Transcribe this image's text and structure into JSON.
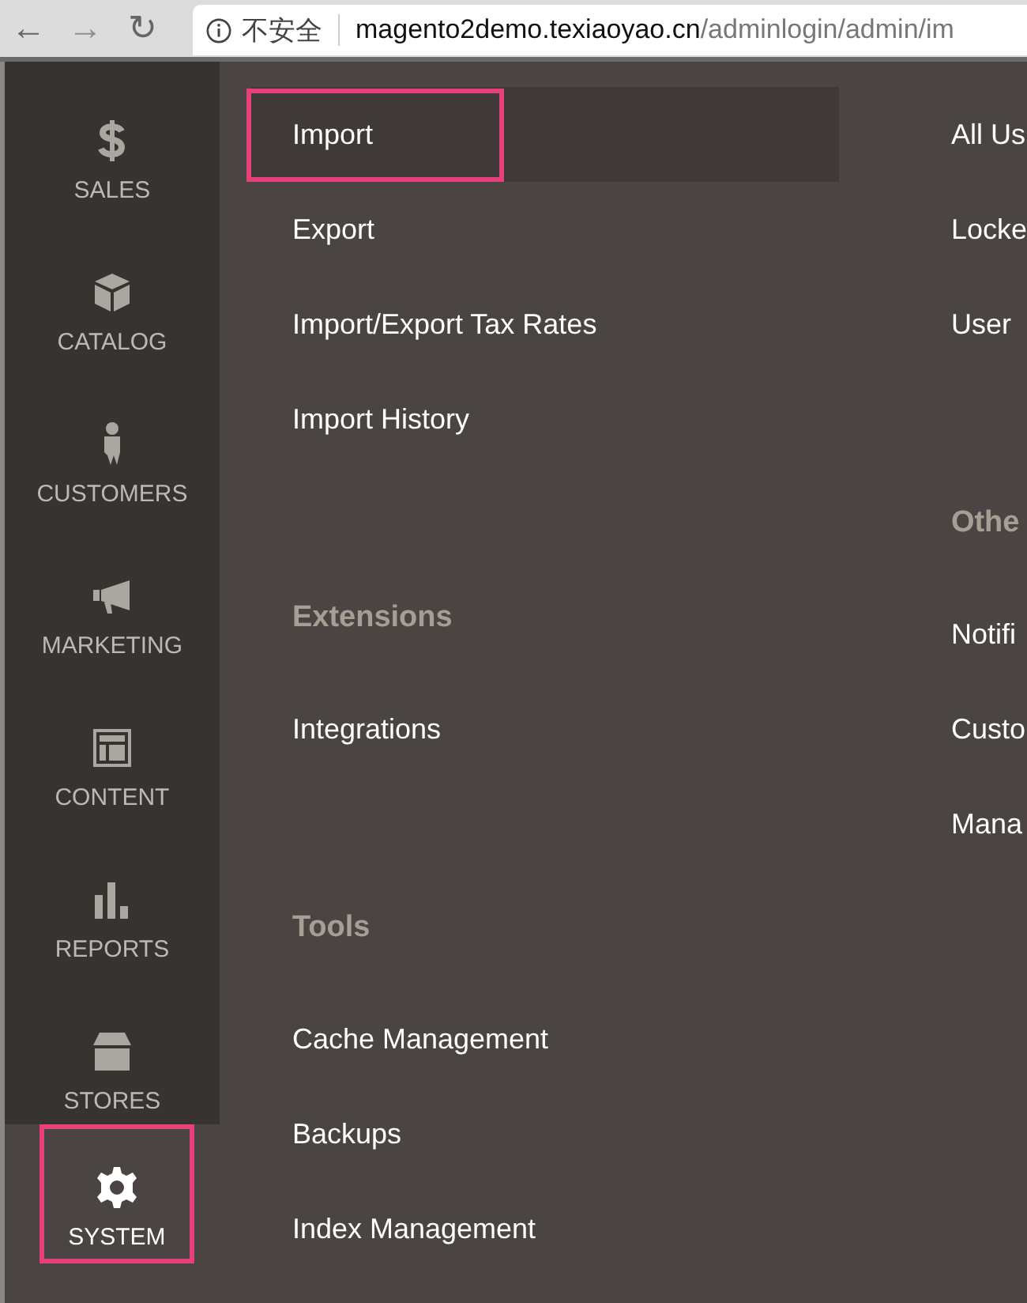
{
  "browser": {
    "nav": [
      {
        "symbol": "←",
        "disabled": false
      },
      {
        "symbol": "→",
        "disabled": true
      },
      {
        "symbol": "↻",
        "disabled": false
      }
    ],
    "security_label": "不安全",
    "host": "magento2demo.texiaoyao.cn",
    "path": "/adminlogin/admin/im"
  },
  "sidebar": {
    "items": [
      {
        "label": "SALES",
        "selected": false
      },
      {
        "label": "CATALOG",
        "selected": false
      },
      {
        "label": "CUSTOMERS",
        "selected": false
      },
      {
        "label": "MARKETING",
        "selected": false
      },
      {
        "label": "CONTENT",
        "selected": false
      },
      {
        "label": "REPORTS",
        "selected": false
      },
      {
        "label": "STORES",
        "selected": false
      },
      {
        "label": "SYSTEM",
        "selected": true
      }
    ]
  },
  "menu": {
    "columns": [
      {
        "sections": [
          {
            "items": [
              {
                "label": "Import",
                "selected": true
              },
              {
                "label": "Export",
                "selected": false
              },
              {
                "label": "Import/Export Tax Rates",
                "selected": false
              },
              {
                "label": "Import History",
                "selected": false
              }
            ]
          },
          {
            "heading": "Extensions",
            "items": [
              {
                "label": "Integrations",
                "selected": false
              }
            ]
          },
          {
            "heading": "Tools",
            "items": [
              {
                "label": "Cache Management",
                "selected": false
              },
              {
                "label": "Backups",
                "selected": false
              },
              {
                "label": "Index Management",
                "selected": false
              }
            ]
          }
        ]
      },
      {
        "sections": [
          {
            "items": [
              {
                "label": "All Us",
                "selected": false
              },
              {
                "label": "Locke",
                "selected": false
              },
              {
                "label": "User",
                "selected": false
              }
            ]
          },
          {
            "heading": "Othe",
            "items": [
              {
                "label": "Notifi",
                "selected": false
              },
              {
                "label": "Custo",
                "selected": false
              },
              {
                "label": "Mana",
                "selected": false
              }
            ]
          }
        ]
      }
    ]
  }
}
